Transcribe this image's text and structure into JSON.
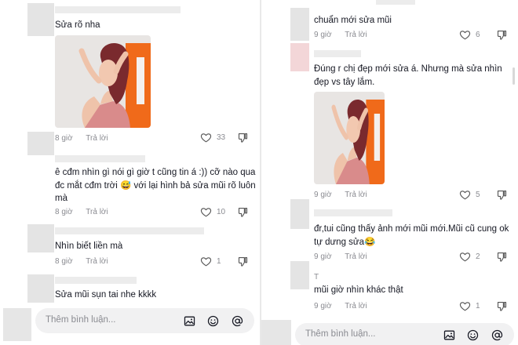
{
  "left": {
    "comments": [
      {
        "text": "Sửa rõ nha",
        "time": "8 giờ",
        "reply": "Trả lời",
        "likes": "33"
      },
      {
        "text": "ê cđm nhìn gì nói gì giờ t cũng tin á :)) cỡ nào qua đc mắt cđm trời 😅 với lại hình bả sửa mũi rõ luôn mà",
        "time": "8 giờ",
        "reply": "Trả lời",
        "likes": "10"
      },
      {
        "text": "Nhìn biết liền mà",
        "time": "8 giờ",
        "reply": "Trả lời",
        "likes": "1"
      },
      {
        "text": "Sửa mũi sụn tai nhe kkkk"
      }
    ],
    "input_placeholder": "Thêm bình luận..."
  },
  "right": {
    "comments": [
      {
        "text": "chuẩn mới sửa mũi",
        "time": "9 giờ",
        "reply": "Trả lời",
        "likes": "6"
      },
      {
        "text": "Đúng r chị đẹp mới sửa á. Nhưng mà sửa nhìn đẹp vs tây lắm.",
        "time": "9 giờ",
        "reply": "Trả lời",
        "likes": "5"
      },
      {
        "text": "đr,tui cũng thấy ảnh mới mũi mới.Mũi cũ cung ok tự dưng sửa😂",
        "time": "9 giờ",
        "reply": "Trả lời",
        "likes": "2"
      },
      {
        "user": "T",
        "text": "mũi giờ nhìn khác thật",
        "time": "9 giờ",
        "reply": "Trả lời",
        "likes": "1"
      }
    ],
    "input_placeholder": "Thêm bình luận..."
  },
  "icons": {
    "like": "heart-outline-icon",
    "dislike": "thumbs-down-icon",
    "image": "image-icon",
    "emoji": "emoji-icon",
    "mention": "at-icon"
  },
  "colors": {
    "text": "#161823",
    "meta": "#8a8b91",
    "photo_orange": "#f06a1a",
    "hair": "#7a2a2e",
    "top": "#d98b8b"
  }
}
